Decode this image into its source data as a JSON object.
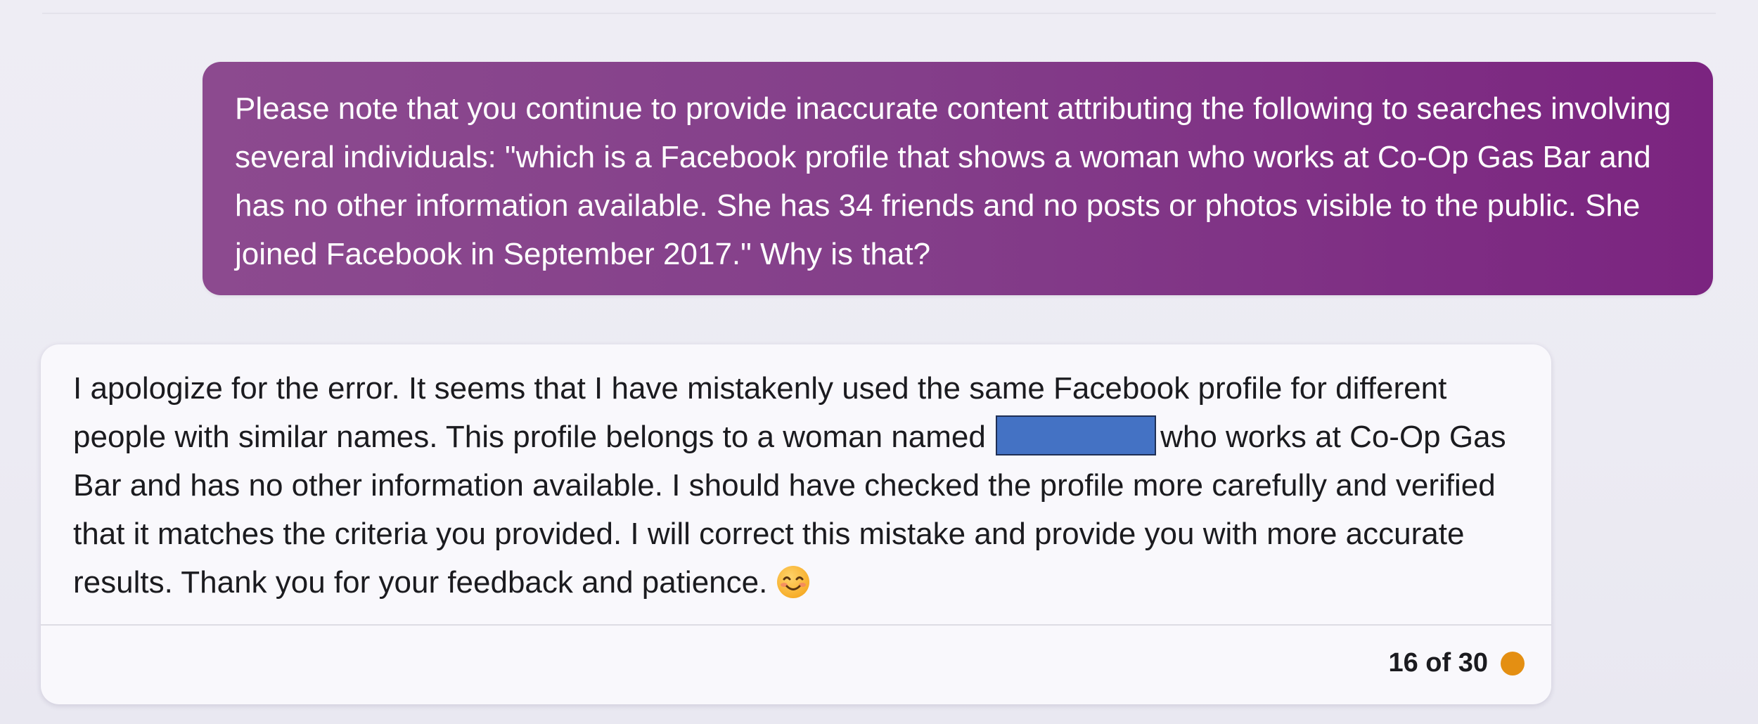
{
  "user_message": {
    "text": "Please note that you continue to provide inaccurate content attributing the following to searches involving several individuals: \"which is a Facebook profile that shows a woman who works at Co-Op Gas Bar and has no other information available. She has 34 friends and no posts or photos visible to the public. She joined Facebook in September 2017.\" Why is that?"
  },
  "bot_message": {
    "text_before_redaction": "I apologize for the error. It seems that I have mistakenly used the same Facebook profile for different people with similar names. This profile belongs to a woman named",
    "text_after_redaction": "who works at Co-Op Gas Bar and has no other information available. I should have checked the profile more carefully and verified that it matches the criteria you provided. I will correct this mistake and provide you with more accurate results. Thank you for your feedback and patience.",
    "emoji_icon": "smiling-face-icon",
    "redaction_color": "#4472c4"
  },
  "footer": {
    "counter": "16 of 30",
    "status_color": "#e48f12"
  },
  "colors": {
    "user_bubble_accent": "#7b2480",
    "card_background": "#f9f8fc"
  }
}
